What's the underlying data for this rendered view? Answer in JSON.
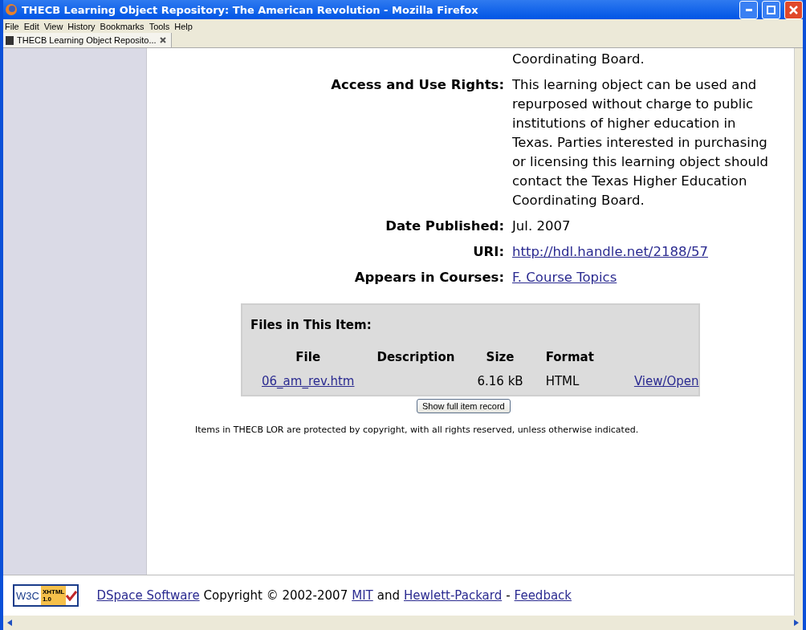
{
  "window": {
    "title": "THECB Learning Object Repository: The American Revolution - Mozilla Firefox"
  },
  "menu": [
    "File",
    "Edit",
    "View",
    "History",
    "Bookmarks",
    "Tools",
    "Help"
  ],
  "tabs": [
    {
      "label": "THECB Learning Object Reposito...",
      "selected": true
    }
  ],
  "metadata": [
    {
      "value": "Coordinating Board.",
      "kind": "text"
    },
    {
      "label": "Access and Use Rights:",
      "value": "This learning object can be used and repurposed without charge to public institutions of higher education in Texas. Parties interested in purchasing or licensing this learning object should contact the Texas Higher Education Coordinating Board.",
      "kind": "text"
    },
    {
      "label": "Date Published:",
      "value": "Jul. 2007",
      "kind": "text"
    },
    {
      "label": "URI:",
      "value": "http://hdl.handle.net/2188/57",
      "kind": "link"
    },
    {
      "label": "Appears in Courses:",
      "value": "F. Course Topics",
      "kind": "link"
    }
  ],
  "files": {
    "title": "Files in This Item:",
    "columns": [
      "File",
      "Description",
      "Size",
      "Format"
    ],
    "rows": [
      {
        "file": "06_am_rev.htm",
        "size": "6.16 kB",
        "format": "HTML",
        "action": "View/Open"
      }
    ]
  },
  "show_full_button": "Show full item record",
  "copyright_notice": "Items in THECB LOR are protected by copyright, with all rights reserved, unless otherwise indicated.",
  "footer": {
    "badge": {
      "w3c": "W3C",
      "xhtml": "XHTML",
      "version": "1.0"
    },
    "parts": [
      {
        "text": "DSpace Software",
        "kind": "link"
      },
      {
        "text": "Copyright © 2002-2007",
        "kind": "text"
      },
      {
        "text": "MIT",
        "kind": "link"
      },
      {
        "text": "and",
        "kind": "text"
      },
      {
        "text": "Hewlett-Packard",
        "kind": "link"
      },
      {
        "text": "-",
        "kind": "text"
      },
      {
        "text": "Feedback",
        "kind": "link"
      }
    ]
  }
}
